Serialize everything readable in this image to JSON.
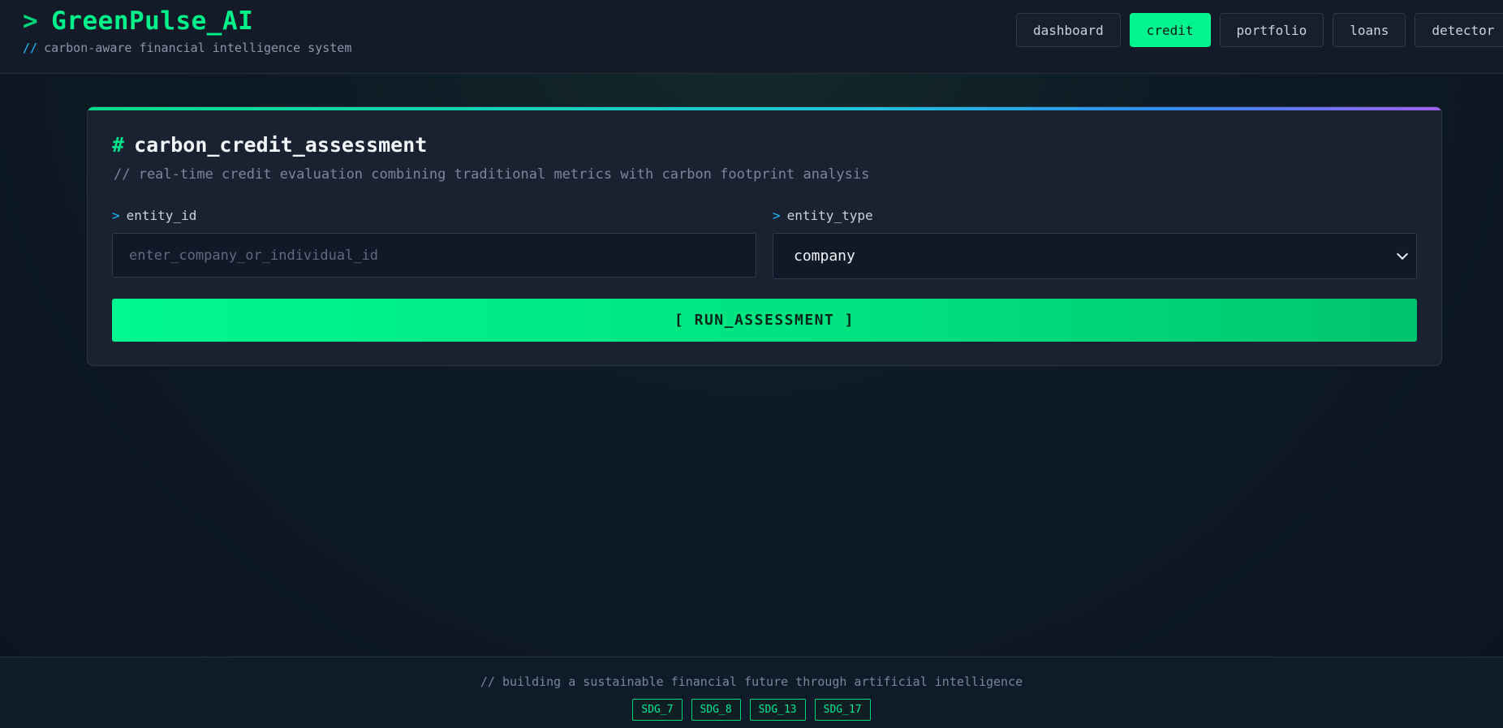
{
  "brand": {
    "prompt": ">",
    "title": "GreenPulse_AI",
    "subtitle_prefix": "//",
    "subtitle": "carbon-aware financial intelligence system"
  },
  "nav": {
    "items": [
      {
        "label": "dashboard",
        "active": false
      },
      {
        "label": "credit",
        "active": true
      },
      {
        "label": "portfolio",
        "active": false
      },
      {
        "label": "loans",
        "active": false
      },
      {
        "label": "detector",
        "active": false
      }
    ]
  },
  "card": {
    "title_prefix": "#",
    "title": "carbon_credit_assessment",
    "description": "// real-time credit evaluation combining traditional metrics with carbon footprint analysis",
    "fields": {
      "entity_id": {
        "label_prefix": ">",
        "label": "entity_id",
        "value": "",
        "placeholder": "enter_company_or_individual_id"
      },
      "entity_type": {
        "label_prefix": ">",
        "label": "entity_type",
        "selected": "company"
      }
    },
    "run_button_label": "[ RUN_ASSESSMENT ]"
  },
  "footer": {
    "text": "// building a sustainable financial future through artificial intelligence",
    "badges": [
      "SDG_7",
      "SDG_8",
      "SDG_13",
      "SDG_17"
    ]
  },
  "colors": {
    "accent": "#00f58f",
    "info": "#1fb8ff",
    "background": "#0b1520",
    "card": "#1a2232"
  },
  "icons": {
    "select_chevron": "chevron-down-icon"
  }
}
